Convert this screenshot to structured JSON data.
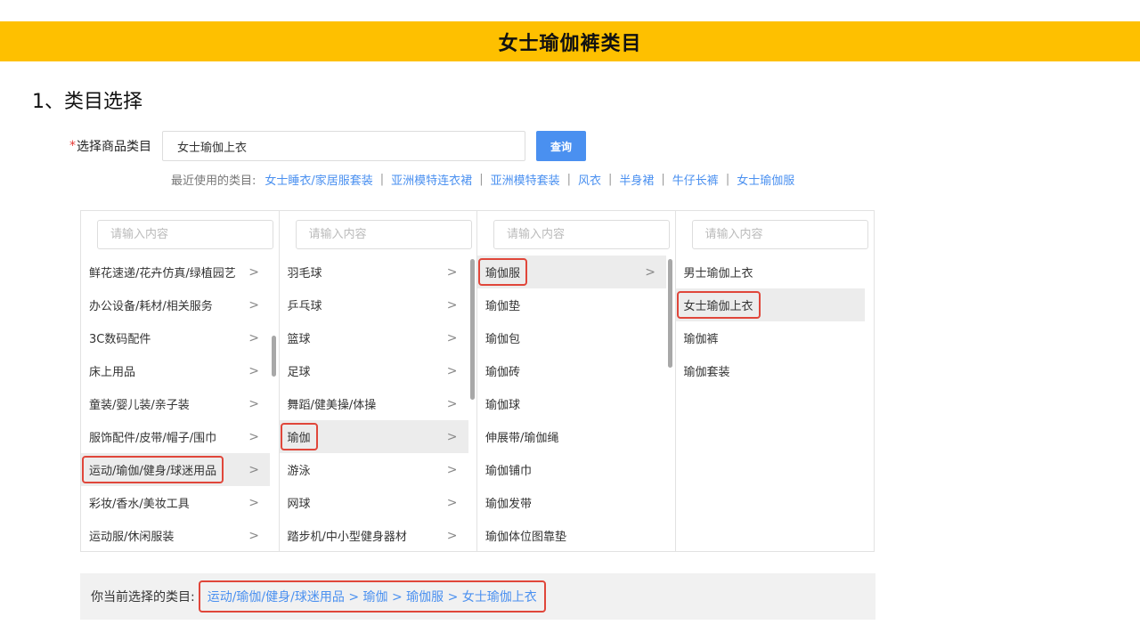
{
  "banner": {
    "title": "女士瑜伽裤类目"
  },
  "section": {
    "heading": "1、类目选择"
  },
  "select": {
    "required_mark": "*",
    "label": "选择商品类目",
    "value": "女士瑜伽上衣",
    "query_button": "查询"
  },
  "recent": {
    "label": "最近使用的类目:",
    "items": [
      "女士睡衣/家居服套装",
      "亚洲模特连衣裙",
      "亚洲模特套装",
      "风衣",
      "半身裙",
      "牛仔长裤",
      "女士瑜伽服"
    ],
    "separator": "|"
  },
  "columns": {
    "placeholder": "请输入内容",
    "col1": [
      "鲜花速递/花卉仿真/绿植园艺",
      "办公设备/耗材/相关服务",
      "3C数码配件",
      "床上用品",
      "童装/婴儿装/亲子装",
      "服饰配件/皮带/帽子/围巾",
      "运动/瑜伽/健身/球迷用品",
      "彩妆/香水/美妆工具",
      "运动服/休闲服装"
    ],
    "col2": [
      "羽毛球",
      "乒乓球",
      "篮球",
      "足球",
      "舞蹈/健美操/体操",
      "瑜伽",
      "游泳",
      "网球",
      "踏步机/中小型健身器材"
    ],
    "col3": [
      "瑜伽服",
      "瑜伽垫",
      "瑜伽包",
      "瑜伽砖",
      "瑜伽球",
      "伸展带/瑜伽绳",
      "瑜伽铺巾",
      "瑜伽发带",
      "瑜伽体位图靠垫"
    ],
    "col4": [
      "男士瑜伽上衣",
      "女士瑜伽上衣",
      "瑜伽裤",
      "瑜伽套装"
    ],
    "chevron": ">"
  },
  "current": {
    "label": "你当前选择的类目:",
    "path": "运动/瑜伽/健身/球迷用品 > 瑜伽 > 瑜伽服 > 女士瑜伽上衣"
  },
  "colors": {
    "banner": "#fec000",
    "accent": "#4a90f0",
    "highlight_border": "#e0463a"
  }
}
